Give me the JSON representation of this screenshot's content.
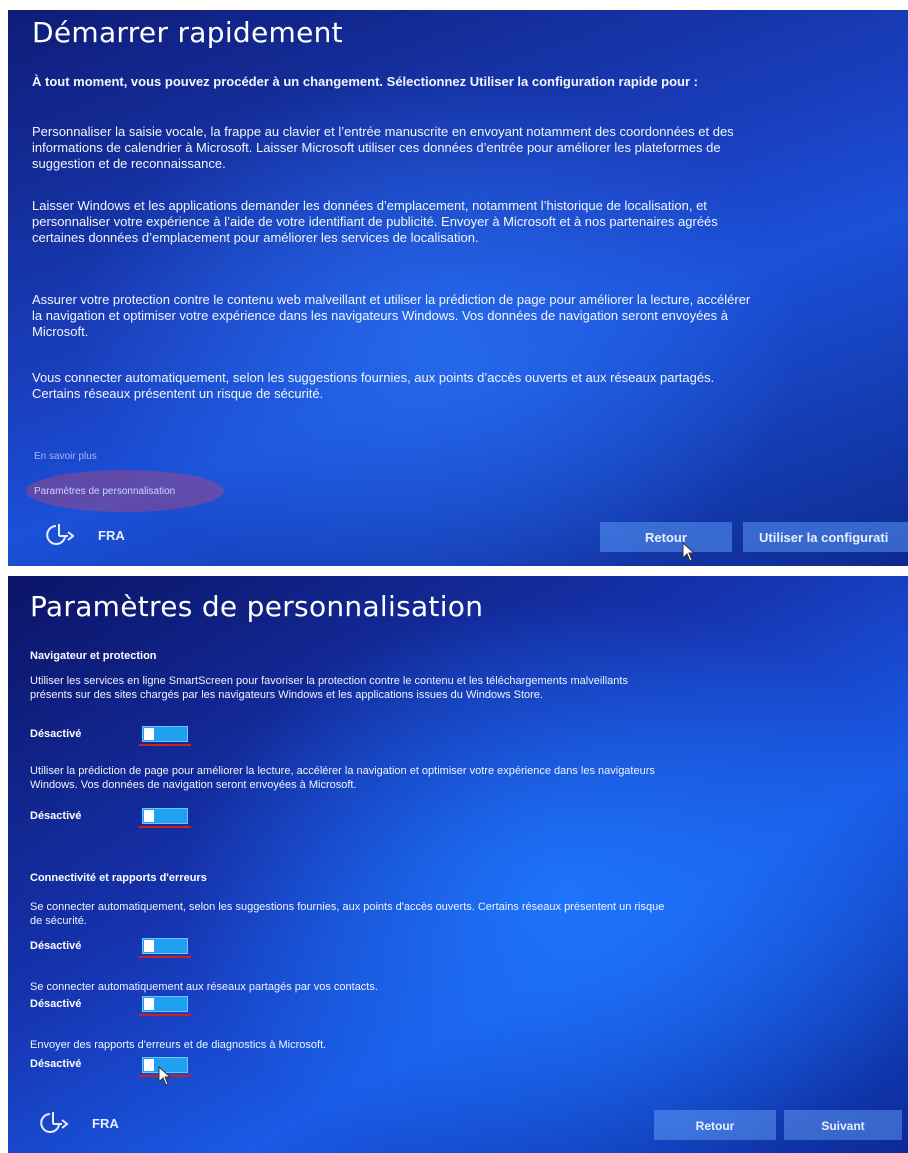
{
  "screen1": {
    "title": "Démarrer rapidement",
    "intro": "À tout moment, vous pouvez procéder à un changement. Sélectionnez Utiliser la configuration rapide pour :",
    "paragraphs": [
      "Personnaliser la saisie vocale, la frappe au clavier et l’entrée manuscrite en envoyant notamment des coordonnées et des informations de calendrier à Microsoft. Laisser Microsoft utiliser ces données d’entrée pour améliorer les plateformes de suggestion et de reconnaissance.",
      "Laisser Windows et les applications demander les données d’emplacement, notamment l’historique de localisation, et personnaliser votre expérience à l’aide de votre identifiant de publicité. Envoyer à Microsoft et à nos partenaires agréés certaines données d’emplacement pour améliorer les services de localisation.",
      "Assurer votre protection contre le contenu web malveillant et utiliser la prédiction de page pour améliorer la lecture, accélérer la navigation et optimiser votre expérience dans les navigateurs Windows. Vos données de navigation seront envoyées à Microsoft.",
      "Vous connecter automatiquement, selon les suggestions fournies, aux points d’accès ouverts et aux réseaux partagés. Certains réseaux présentent un risque de sécurité."
    ],
    "learn_more": "En savoir plus",
    "customize_link": "Paramètres de personnalisation",
    "lang": "FRA",
    "back_label": "Retour",
    "express_label": "Utiliser la configurati"
  },
  "screen2": {
    "title": "Paramètres de personnalisation",
    "section1": "Navigateur et protection",
    "section2": "Connectivité et rapports d'erreurs",
    "settings": [
      {
        "desc": "Utiliser les services en ligne SmartScreen pour favoriser la protection contre le contenu et les téléchargements malveillants présents sur des sites chargés par les navigateurs Windows et les applications issues du Windows Store.",
        "state": "Désactivé"
      },
      {
        "desc": "Utiliser la prédiction de page pour améliorer la lecture, accélérer la navigation et optimiser votre expérience dans les navigateurs Windows. Vos données de navigation seront envoyées à Microsoft.",
        "state": "Désactivé"
      },
      {
        "desc": "Se connecter automatiquement, selon les suggestions fournies, aux points d'accès ouverts. Certains réseaux présentent un risque de sécurité.",
        "state": "Désactivé"
      },
      {
        "desc": "Se connecter automatiquement aux réseaux partagés par vos contacts.",
        "state": "Désactivé"
      },
      {
        "desc": "Envoyer des rapports d'erreurs et de diagnostics à Microsoft.",
        "state": "Désactivé"
      }
    ],
    "lang": "FRA",
    "back_label": "Retour",
    "next_label": "Suivant"
  },
  "colors": {
    "toggle_track": "#1fa0f0",
    "underline": "#d0201a",
    "link": "#9fb8ff"
  },
  "icons": {
    "ease_of_access": "ease-of-access-icon",
    "cursor": "mouse-pointer-icon"
  }
}
